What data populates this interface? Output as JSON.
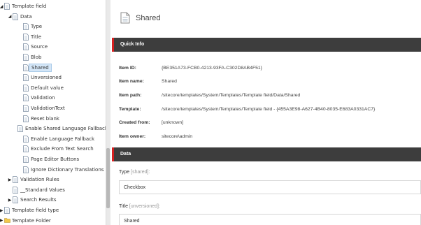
{
  "tree": {
    "items": [
      {
        "label": "Template field",
        "expand": "open"
      },
      {
        "label": "Data",
        "expand": "open"
      },
      {
        "label": "Type"
      },
      {
        "label": "Title"
      },
      {
        "label": "Source"
      },
      {
        "label": "Blob"
      },
      {
        "label": "Shared",
        "selected": true
      },
      {
        "label": "Unversioned"
      },
      {
        "label": "Default value"
      },
      {
        "label": "Validation"
      },
      {
        "label": "ValidationText"
      },
      {
        "label": "Reset blank"
      },
      {
        "label": "Enable Shared Language Fallback"
      },
      {
        "label": "Enable Language Fallback"
      },
      {
        "label": "Exclude From Text Search"
      },
      {
        "label": "Page Editor Buttons"
      },
      {
        "label": "Ignore Dictionary Translations"
      },
      {
        "label": "Validation Rules",
        "expand": "closed"
      },
      {
        "label": "__Standard Values"
      },
      {
        "label": "Search Results",
        "expand": "closed"
      },
      {
        "label": "Template field type",
        "expand": "closed"
      },
      {
        "label": "Template Folder",
        "expand": "closed"
      }
    ]
  },
  "header": {
    "title": "Shared"
  },
  "quick_info": {
    "title": "Quick Info",
    "rows": [
      {
        "key": "Item ID:",
        "value": "{BE351A73-FCB0-4213-93FA-C302D8AB4F51}"
      },
      {
        "key": "Item name:",
        "value": "Shared"
      },
      {
        "key": "Item path:",
        "value": "/sitecore/templates/System/Templates/Template field/Data/Shared"
      },
      {
        "key": "Template:",
        "value": "/sitecore/templates/System/Templates/Template field - {455A3E98-A627-4B40-8035-E683A0331AC7}"
      },
      {
        "key": "Created from:",
        "value": "[unknown]"
      },
      {
        "key": "Item owner:",
        "value": "sitecore\\admin"
      }
    ]
  },
  "data_section": {
    "title": "Data",
    "fields": [
      {
        "label": "Type",
        "note": "[shared]:",
        "value": "Checkbox"
      },
      {
        "label": "Title",
        "note": "[unversioned]:",
        "value": "Shared"
      }
    ]
  },
  "colors": {
    "section_bar": "#3d3d3d",
    "accent": "#d62020",
    "selected": "#d4e6f7"
  }
}
